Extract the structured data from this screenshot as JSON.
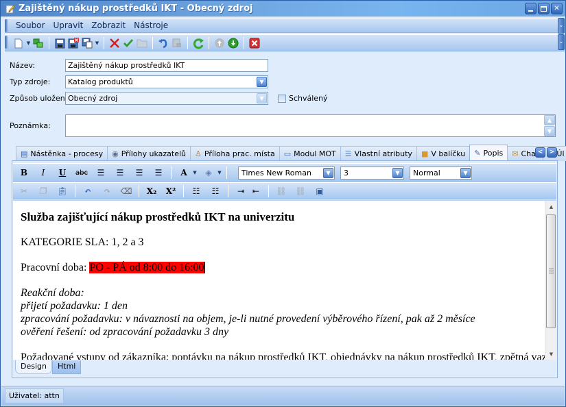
{
  "window": {
    "title": "Zajištěný nákup prostředků IKT - Obecný zdroj",
    "controls": {
      "minimize": "_",
      "maximize": "□",
      "close": "✕"
    }
  },
  "menu": {
    "items": [
      "Soubor",
      "Upravit",
      "Zobrazit",
      "Nástroje"
    ]
  },
  "toolbar": {
    "icons": [
      "new-document-icon",
      "dropdown-arrow",
      "copy-objects-icon",
      "save-icon",
      "save-close-icon",
      "save-as-icon",
      "dropdown-arrow",
      "delete-icon",
      "approve-icon",
      "open-folder-icon",
      "undo-icon",
      "properties-icon",
      "refresh-icon",
      "move-up-icon",
      "move-down-icon",
      "close-window-icon"
    ]
  },
  "form": {
    "nazev_label": "Název:",
    "nazev_value": "Zajištěný nákup prostředků IKT",
    "typ_label": "Typ zdroje:",
    "typ_value": "Katalog produktů",
    "zpusob_label": "Způsob uložení:",
    "zpusob_value": "Obecný zdroj",
    "schvaleny_label": "Schválený",
    "schvaleny_checked": false,
    "poznamka_label": "Poznámka:",
    "poznamka_value": ""
  },
  "tabs": [
    {
      "label": "Nástěnka - procesy",
      "icon": "▤",
      "active": false
    },
    {
      "label": "Přílohy ukazatelů",
      "icon": "◉",
      "active": false
    },
    {
      "label": "Příloha prac. místa",
      "icon": "♙",
      "active": false
    },
    {
      "label": "Modul MOT",
      "icon": "▭",
      "active": false
    },
    {
      "label": "Vlastní atributy",
      "icon": "☰",
      "active": false
    },
    {
      "label": "V balíčku",
      "icon": "■",
      "active": false
    },
    {
      "label": "Popis",
      "icon": "✎",
      "active": true
    },
    {
      "label": "Chat",
      "icon": "✉",
      "active": false
    },
    {
      "label": "Úl",
      "icon": "✉",
      "active": false
    }
  ],
  "tab_nav": {
    "prev": "<",
    "next": ">"
  },
  "editor_toolbar": {
    "bold": "B",
    "italic": "I",
    "underline": "U",
    "strike": "abc",
    "font_color": "A",
    "font_name": "Times New Roman",
    "font_size": "3",
    "paragraph_style": "Normal",
    "subscript": "X₂",
    "superscript": "X²"
  },
  "editor_content": {
    "heading": "Služba zajišťující nákup prostředků IKT na univerzitu",
    "kategorie": "KATEGORIE SLA: 1, 2 a 3",
    "pracovni_label": "Pracovní doba: ",
    "pracovni_value": "PO - PÁ od 8:00 do 16:00",
    "reakcni": "Reakční doba:",
    "prijeti": "přijetí požadavku: 1 den",
    "zpracovani": "zpracování požadavku: v návaznosti na objem, je-li nutné provedení výběrového řízení, pak až 2 měsíce",
    "overeni": "ověření řešení: od zpracování požadavku 3 dny",
    "pozadovane": "Požadované vstupy od zákazníka: poptávku na nákup prostředků IKT, objednávky na nákup prostředků IKT, zpětná vazba",
    "highlight_color": "#ff0000"
  },
  "mode_tabs": [
    {
      "label": "Design",
      "active": true
    },
    {
      "label": "Html",
      "active": false
    }
  ],
  "status": {
    "user": "Uživatel: attn"
  }
}
